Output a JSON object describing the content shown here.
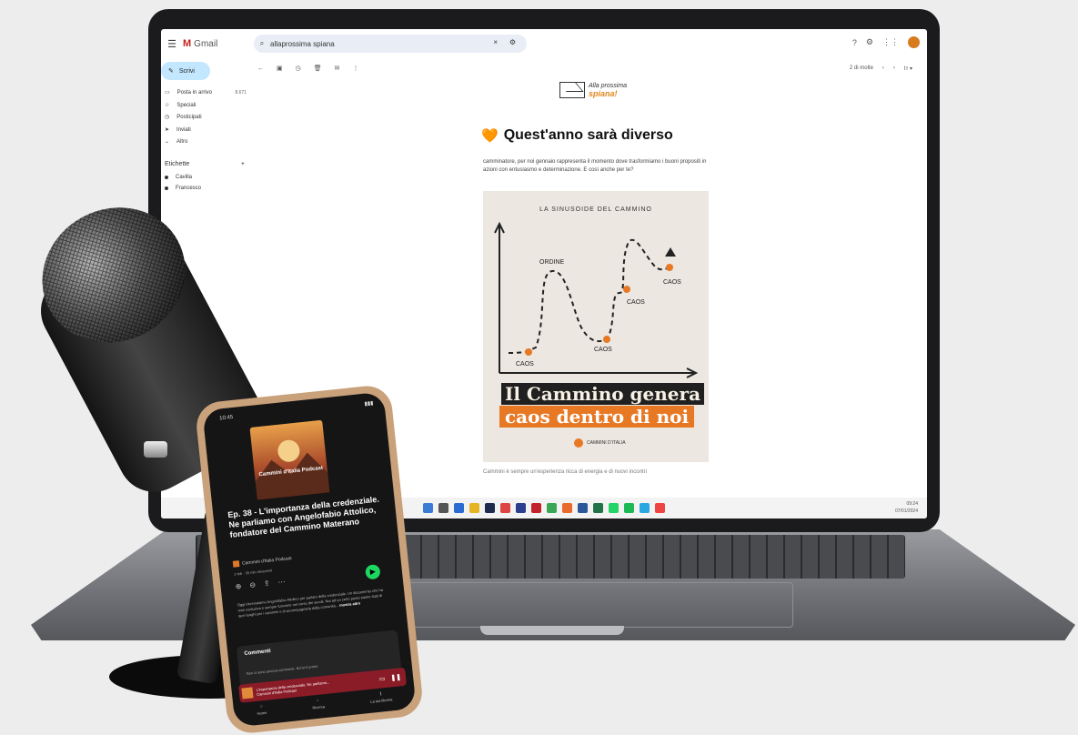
{
  "gmail": {
    "menu_icon": "☰",
    "logo": "M",
    "app_name": "Gmail",
    "search_value": "allaprossima spiana",
    "search_clear": "×",
    "search_tune": "⚙",
    "compose_label": "Scrivi",
    "nav": [
      {
        "icon": "▭",
        "label": "Posta in arrivo",
        "count": "8.671"
      },
      {
        "icon": "☆",
        "label": "Speciali",
        "count": ""
      },
      {
        "icon": "◷",
        "label": "Posticipati",
        "count": ""
      },
      {
        "icon": "➤",
        "label": "Inviati",
        "count": ""
      },
      {
        "icon": "⌄",
        "label": "Altro",
        "count": ""
      }
    ],
    "labels_heading": "Etichette",
    "labels_add": "+",
    "labels": [
      "Cavilla",
      "Francesco"
    ],
    "toolbar": {
      "back": "←",
      "archive": "▣",
      "snooze": "◷",
      "delete": "🗑",
      "mail": "✉",
      "more": "⋮",
      "pager": "2 di molte",
      "prev": "‹",
      "next": "›",
      "lang": "Iт ▾"
    }
  },
  "email": {
    "brand_line1": "Alla prossima",
    "brand_line2": "spiana!",
    "heart": "🧡",
    "headline": "Quest'anno sarà diverso",
    "body": "camminatore, per noi gennaio rappresenta il momento dove trasformiamo i buoni propositi in azioni con entusiasmo e determinazione. E così anche per te?",
    "poster_title": "LA SINUSOIDE DEL CAMMINO",
    "chart_labels": [
      "ORDINE",
      "CAOS",
      "CAOS",
      "CAOS",
      "CAOS"
    ],
    "banner_line1": "Il Cammino genera",
    "banner_line2": "caos dentro di noi",
    "poster_logo": "CAMMINI D'ITALIA",
    "after_text": "Cammini è sempre un'esperienza ricca di energia e di nuovi incontri"
  },
  "taskbar": {
    "time": "09:24",
    "date": "07/01/2024"
  },
  "phone": {
    "time": "10:45",
    "battery": "▮▮▮",
    "cover_title": "Cammini d'Italia Podcast",
    "episode_title": "Ep. 38 - L'importanza della credenziale. Ne parliamo con Angelofabio Attolico, fondatore del Cammino Materano",
    "podcast_name": "Cammini d'Italia Podcast",
    "meta": "3 feb · 35 min rimanenti",
    "play": "▶",
    "description": "Oggi intervistiamo Angelofabio Attolico per parlare della credenziale. Un documento che ha reso esclusiva e sempre funzione nel corso dei secoli. Noi ad un certo punto siamo stati di quei luoghi per i cammini e di accompagnarla dalla comunità...",
    "more": "mostra altro",
    "comments_heading": "Commenti",
    "comments_text": "Non ci sono ancora commenti. Scrivi il primo",
    "mini_title": "L'importanza della credenziale. Ne parliamo...",
    "mini_sub": "Cammini d'Italia Podcast",
    "tabs": [
      "Home",
      "Ricerca",
      "La tua libreria"
    ]
  }
}
